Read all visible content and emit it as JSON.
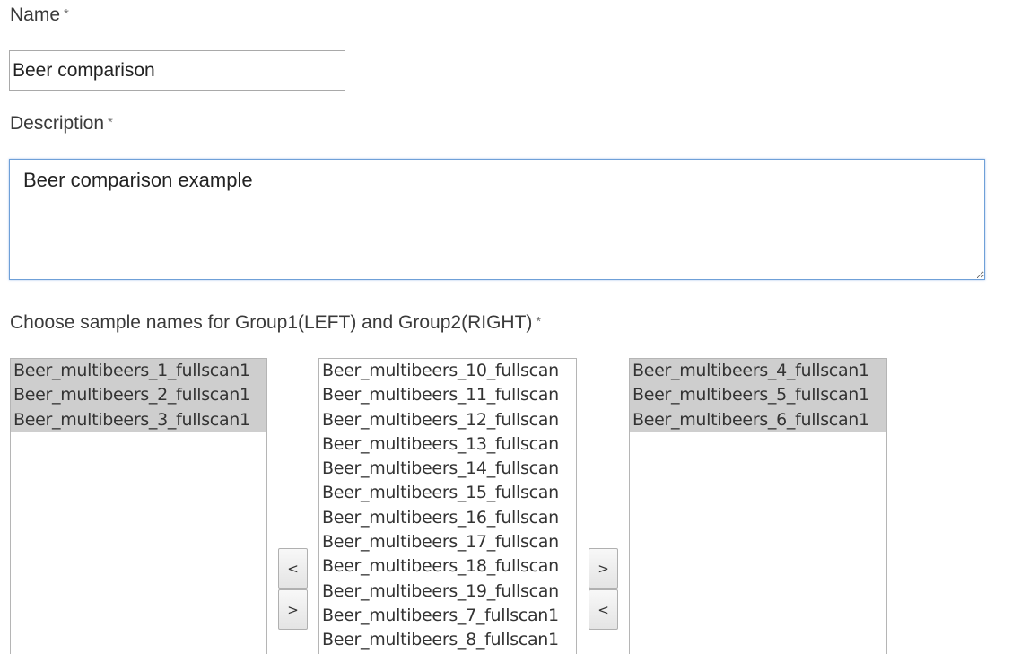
{
  "form": {
    "name_label": "Name",
    "name_required": "*",
    "name_value": "Beer comparison",
    "description_label": "Description",
    "description_required": "*",
    "description_value": "Beer comparison example",
    "groups_label": "Choose sample names for Group1(LEFT) and Group2(RIGHT)",
    "groups_required": "*"
  },
  "group_left": {
    "items": [
      "Beer_multibeers_1_fullscan1",
      "Beer_multibeers_2_fullscan1",
      "Beer_multibeers_3_fullscan1"
    ]
  },
  "available": {
    "items": [
      "Beer_multibeers_10_fullscan",
      "Beer_multibeers_11_fullscan",
      "Beer_multibeers_12_fullscan",
      "Beer_multibeers_13_fullscan",
      "Beer_multibeers_14_fullscan",
      "Beer_multibeers_15_fullscan",
      "Beer_multibeers_16_fullscan",
      "Beer_multibeers_17_fullscan",
      "Beer_multibeers_18_fullscan",
      "Beer_multibeers_19_fullscan",
      "Beer_multibeers_7_fullscan1",
      "Beer_multibeers_8_fullscan1"
    ]
  },
  "group_right": {
    "items": [
      "Beer_multibeers_4_fullscan1",
      "Beer_multibeers_5_fullscan1",
      "Beer_multibeers_6_fullscan1"
    ]
  },
  "buttons": {
    "left_move_to_left": "<",
    "left_move_to_right": ">",
    "right_move_to_right": ">",
    "right_move_to_left": "<"
  },
  "colors": {
    "selected_bg": "#cecece",
    "focus_border": "#6fa0d8"
  }
}
